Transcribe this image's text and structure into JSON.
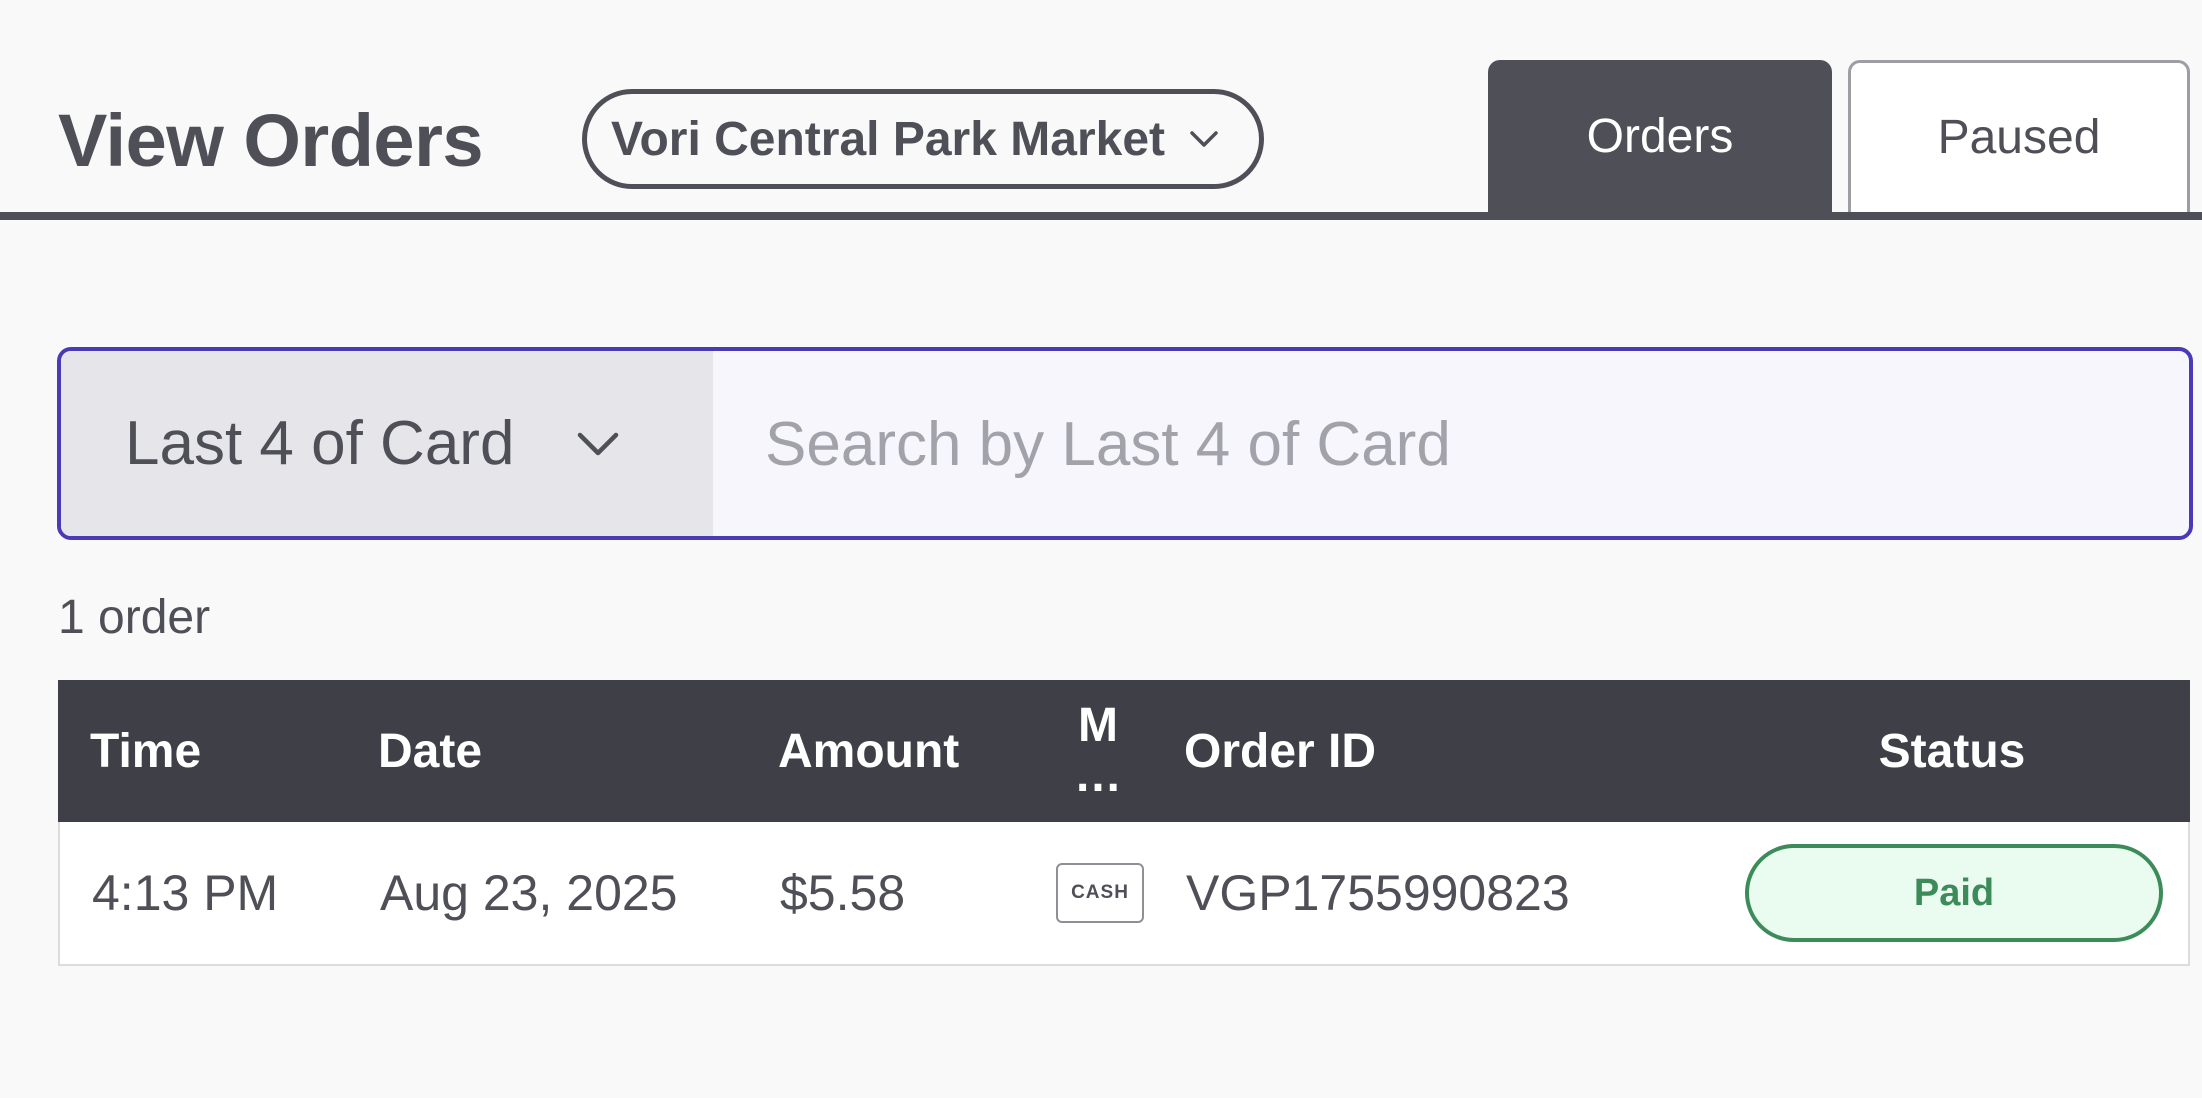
{
  "header": {
    "title": "View Orders",
    "store_select": "Vori Central Park Market",
    "tabs": [
      {
        "label": "Orders",
        "active": true
      },
      {
        "label": "Paused",
        "active": false
      }
    ]
  },
  "search": {
    "type_label": "Last 4 of Card",
    "placeholder": "Search by Last 4 of Card",
    "value": ""
  },
  "results": {
    "count_text": "1 order"
  },
  "table": {
    "columns": [
      "Time",
      "Date",
      "Amount",
      "M…",
      "Order ID",
      "Status"
    ],
    "method_col_line1": "M",
    "method_col_line2": "…",
    "rows": [
      {
        "time": "4:13 PM",
        "date": "Aug 23, 2025",
        "amount": "$5.58",
        "method": "CASH",
        "order_id": "VGP1755990823",
        "status": "Paid"
      }
    ]
  },
  "colors": {
    "dark": "#4f4f58",
    "table_header": "#3f3f47",
    "focus_border": "#4a3ab8",
    "status_paid": "#3c8c5a",
    "status_paid_bg": "#eafbf0"
  },
  "icons": [
    "chevron-down-icon",
    "cash-icon"
  ]
}
